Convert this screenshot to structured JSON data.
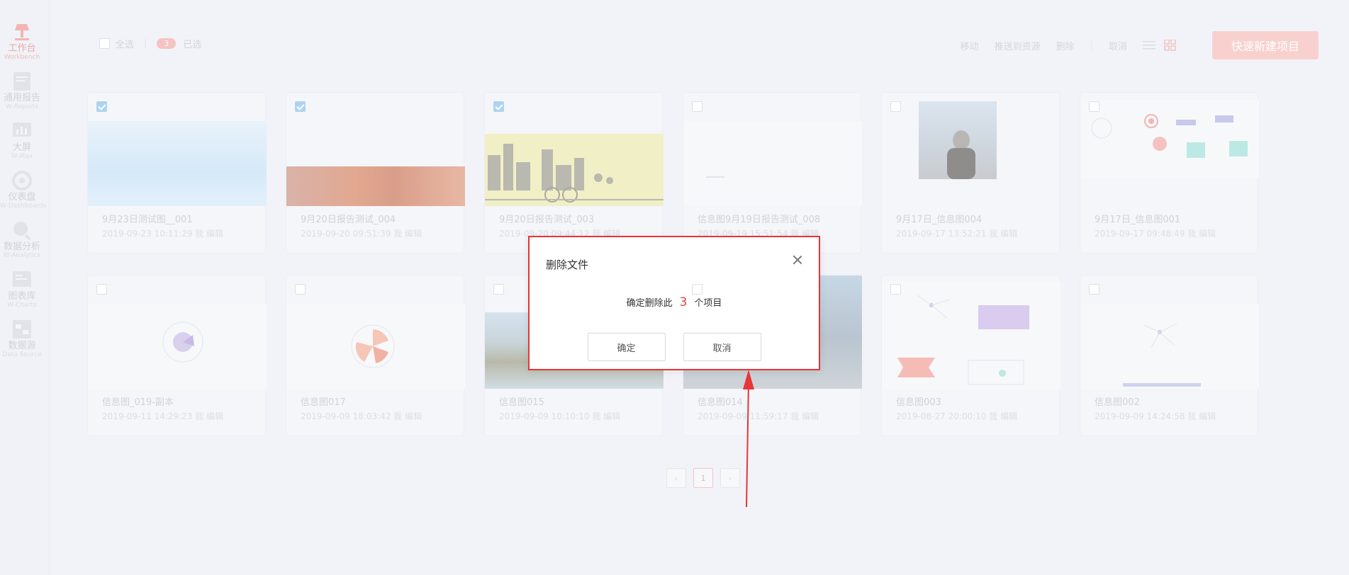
{
  "sidebar": {
    "items": [
      {
        "label": "工作台",
        "en": "Workbench",
        "icon": "workbench-icon",
        "active": true
      },
      {
        "label": "通用报告",
        "en": "W-Reports",
        "icon": "report-icon"
      },
      {
        "label": "大屏",
        "en": "W-Max",
        "icon": "bigscreen-icon"
      },
      {
        "label": "仪表盘",
        "en": "W-Dashboards",
        "icon": "dashboard-icon"
      },
      {
        "label": "数据分析",
        "en": "W-Analytics",
        "icon": "analytics-icon"
      },
      {
        "label": "图表库",
        "en": "W-Charts",
        "icon": "chart-library-icon"
      },
      {
        "label": "数据源",
        "en": "Data Source",
        "icon": "datasource-icon"
      }
    ]
  },
  "toolbar": {
    "select_all": "全选",
    "selected_count": "3",
    "selected_label": "已选",
    "actions": [
      "移动",
      "推送到资源",
      "删除"
    ],
    "cancel": "取消",
    "new_project": "快速新建项目"
  },
  "cards": [
    {
      "title": "9月23日测试图__001",
      "meta": "2019-09-23 10:11:29 我 编辑",
      "checked": true,
      "thumb": "sky-photo"
    },
    {
      "title": "9月20日报告测试_004",
      "meta": "2019-09-20 09:51:39 我 编辑",
      "checked": true,
      "thumb": "fire-photo"
    },
    {
      "title": "9月20日报告测试_003",
      "meta": "2019-09-20 09:44:12 我 编辑",
      "checked": true,
      "thumb": "city-illustration"
    },
    {
      "title": "信息图9月19日报告测试_008",
      "meta": "2019-09-19 15:51:54 我 编辑",
      "checked": false,
      "thumb": "blank-doc"
    },
    {
      "title": "9月17日_信息图004",
      "meta": "2019-09-17 13:52:21 我 编辑",
      "checked": false,
      "thumb": "portrait-photo"
    },
    {
      "title": "9月17日_信息图001",
      "meta": "2019-09-17 09:48:49 我 编辑",
      "checked": false,
      "thumb": "infographic-shapes"
    },
    {
      "title": "信息图_019-副本",
      "meta": "2019-09-11 14:29:23 我 编辑",
      "checked": false,
      "thumb": "radar-purple"
    },
    {
      "title": "信息图017",
      "meta": "2019-09-09 18:03:42 我 编辑",
      "checked": false,
      "thumb": "radar-orange"
    },
    {
      "title": "信息图015",
      "meta": "2019-09-09 10:10:10 我 编辑",
      "checked": false,
      "thumb": "coast-photo"
    },
    {
      "title": "信息图014",
      "meta": "2019-09-09 11:59:17 我 编辑",
      "checked": false,
      "thumb": "pier-photo"
    },
    {
      "title": "信息图003",
      "meta": "2019-08-27 20:00:10 我 编辑",
      "checked": false,
      "thumb": "mixed-charts"
    },
    {
      "title": "信息图002",
      "meta": "2019-09-09 14:24:58 我 编辑",
      "checked": false,
      "thumb": "network-chart"
    }
  ],
  "pagination": {
    "prev": "‹",
    "current": "1",
    "next": "›"
  },
  "dialog": {
    "title": "删除文件",
    "message_prefix": "确定删除此",
    "count": "3",
    "message_suffix": "个项目",
    "confirm": "确定",
    "cancel": "取消"
  },
  "colors": {
    "accent": "#e73538",
    "brand": "#f3b5b2",
    "checked": "#aed3f2"
  }
}
